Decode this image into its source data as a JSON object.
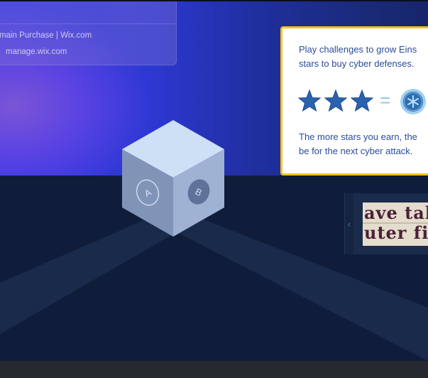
{
  "tooltip": {
    "line1": "main Purchase | Wix.com",
    "line2": "manage.wix.com"
  },
  "info_card": {
    "line1": "Play challenges to grow Eins",
    "line2": "stars to buy cyber defenses.",
    "equals": "=",
    "line3": "The more stars you earn, the",
    "line4": "be for the next cyber attack.",
    "star_count": 3
  },
  "cube": {
    "face_left_label": "A",
    "face_right_label": "B"
  },
  "clue_panel": {
    "prev_glyph": "‹",
    "clip_line1": "ave tak",
    "clip_line2": "uter file"
  },
  "colors": {
    "card_border": "#f3c21b",
    "card_text": "#2b4c9a",
    "star_fill": "#2b62b0",
    "floor": "#0f1d3a",
    "sky": "#3436e4"
  }
}
